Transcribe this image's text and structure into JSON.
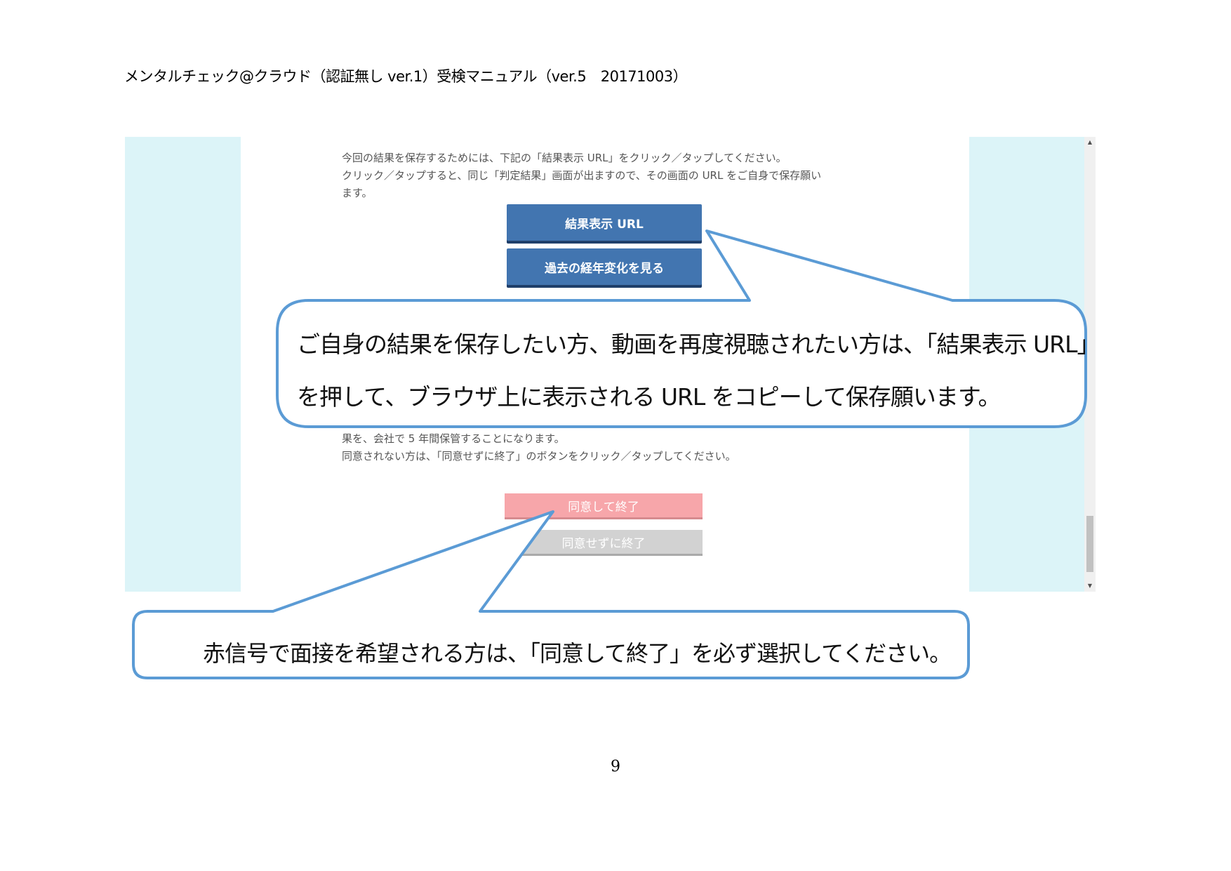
{
  "document": {
    "header": "メンタルチェック@クラウド（認証無し ver.1）受検マニュアル（ver.5　20171003）",
    "page_number": "9"
  },
  "screenshot": {
    "intro_lines": [
      "今回の結果を保存するためには、下記の「結果表示 URL」をクリック／タップしてください。",
      "クリック／タップすると、同じ「判定結果」画面が出ますので、その画面の URL をご自身で保存願い",
      "ます。"
    ],
    "results_url_button": "結果表示 URL",
    "history_button": "過去の経年変化を見る",
    "consent_lines": [
      "果を、会社で 5 年間保管することになります。",
      "同意されない方は、「同意せずに終了」のボタンをクリック／タップしてください。"
    ],
    "agree_button": "同意して終了",
    "decline_button": "同意せずに終了"
  },
  "callouts": {
    "save_url_line1": "ご自身の結果を保存したい方、動画を再度視聴されたい方は、「結果表示 URL」",
    "save_url_line2": "を押して、ブラウザ上に表示される URL をコピーして保存願います。",
    "interview_note": "赤信号で面接を希望される方は、「同意して終了」を必ず選択してください。"
  },
  "colors": {
    "side_panel": "#dcf4f8",
    "primary_button": "#4275b0",
    "agree_button": "#f7a6aa",
    "decline_button": "#d2d2d2",
    "callout_border": "#5b9bd5"
  }
}
